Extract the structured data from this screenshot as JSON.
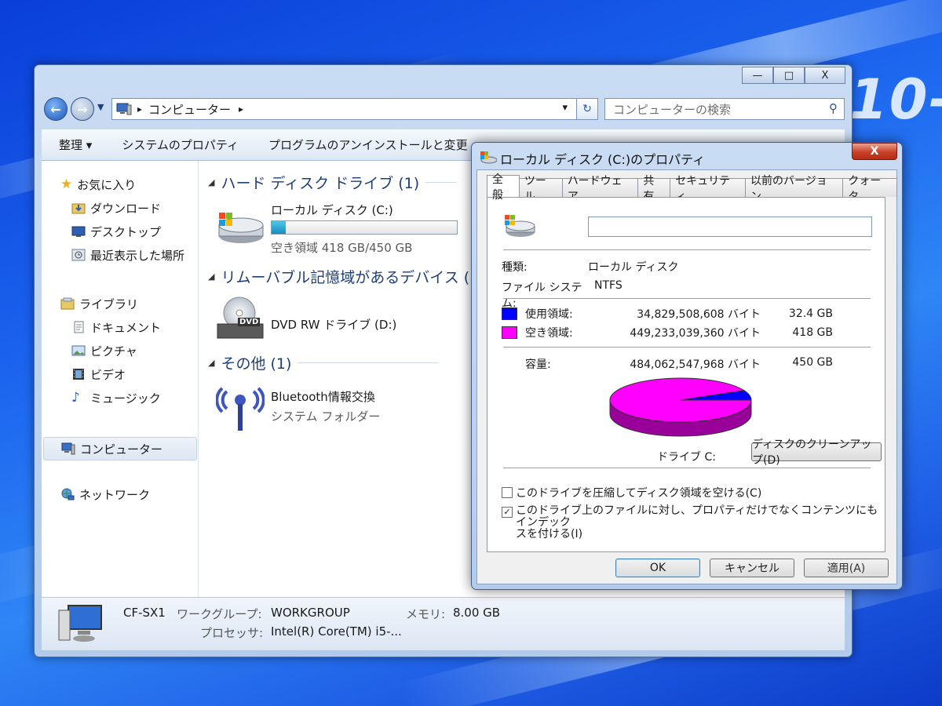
{
  "colors": {
    "used": "#0000ff",
    "free": "#ff00ff",
    "desktop": "#1f5fe6"
  },
  "desktop": {
    "watermark": "10-"
  },
  "explorer": {
    "caption_buttons": {
      "minimize": "—",
      "maximize": "□",
      "close": "X"
    },
    "nav": {
      "back": "←",
      "forward": "→"
    },
    "address": {
      "sep": "▸",
      "location": "コンピューター",
      "sep2": "▸",
      "dropdown": "▾"
    },
    "refresh": "↻",
    "search": {
      "placeholder": "コンピューターの検索",
      "icon": "search-icon"
    },
    "toolbar": {
      "organize": "整理 ▾",
      "system_properties": "システムのプロパティ",
      "uninstall": "プログラムのアンインストールと変更"
    },
    "sidebar": {
      "favorites": {
        "label": "お気に入り",
        "items": [
          "ダウンロード",
          "デスクトップ",
          "最近表示した場所"
        ]
      },
      "libraries": {
        "label": "ライブラリ",
        "items": [
          "ドキュメント",
          "ピクチャ",
          "ビデオ",
          "ミュージック"
        ]
      },
      "computer": "コンピューター",
      "network": "ネットワーク"
    },
    "groups": [
      {
        "title": "ハード ディスク ドライブ (1)",
        "items": [
          {
            "name": "ローカル ディスク (C:)",
            "detail": "空き領域 418 GB/450 GB",
            "used_fraction": 0.077
          }
        ]
      },
      {
        "title": "リムーバブル記憶域があるデバイス (",
        "items": [
          {
            "name": "DVD RW ドライブ (D:)",
            "icon_label": "DVD"
          }
        ]
      },
      {
        "title": "その他 (1)",
        "items": [
          {
            "name": "Bluetooth情報交換",
            "detail": "システム フォルダー"
          }
        ]
      }
    ],
    "status": {
      "computer_name": "CF-SX1",
      "workgroup_label": "ワークグループ:",
      "workgroup": "WORKGROUP",
      "memory_label": "メモリ:",
      "memory": "8.00 GB",
      "processor_label": "プロセッサ:",
      "processor": "Intel(R) Core(TM) i5-..."
    }
  },
  "dialog": {
    "title": "ローカル ディスク (C:)のプロパティ",
    "close": "X",
    "tabs": [
      "全般",
      "ツール",
      "ハードウェア",
      "共有",
      "セキュリティ",
      "以前のバージョン",
      "クォータ"
    ],
    "name_value": "",
    "type_label": "種類:",
    "type_value": "ローカル ディスク",
    "fs_label": "ファイル システム:",
    "fs_value": "NTFS",
    "used": {
      "label": "使用領域:",
      "bytes": "34,829,508,608 バイト",
      "size": "32.4 GB"
    },
    "free": {
      "label": "空き領域:",
      "bytes": "449,233,039,360 バイト",
      "size": "418 GB"
    },
    "capacity": {
      "label": "容量:",
      "bytes": "484,062,547,968 バイト",
      "size": "450 GB"
    },
    "drive_label": "ドライブ C:",
    "cleanup_button": "ディスクのクリーンアップ(D)",
    "compress": {
      "label": "このドライブを圧縮してディスク領域を空ける(C)",
      "checked": false
    },
    "index": {
      "label_line1": "このドライブ上のファイルに対し、プロパティだけでなくコンテンツにもインデック",
      "label_line2": "スを付ける(I)",
      "checked": true,
      "mark": "✓"
    },
    "buttons": {
      "ok": "OK",
      "cancel": "キャンセル",
      "apply": "適用(A)"
    }
  },
  "chart_data": {
    "type": "pie",
    "categories": [
      "使用領域",
      "空き領域"
    ],
    "values": [
      32.4,
      418
    ],
    "title": "",
    "colors": [
      "#0000ff",
      "#ff00ff"
    ]
  }
}
